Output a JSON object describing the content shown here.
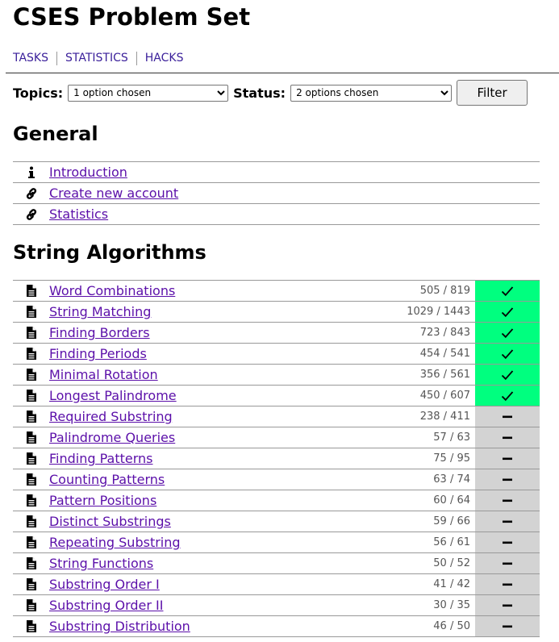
{
  "header": {
    "title": "CSES Problem Set"
  },
  "nav": [
    {
      "label": "TASKS"
    },
    {
      "label": "STATISTICS"
    },
    {
      "label": "HACKS"
    }
  ],
  "filter": {
    "topics_label": "Topics:",
    "topics_value": "1 option chosen",
    "status_label": "Status:",
    "status_value": "2 options chosen",
    "button_label": "Filter"
  },
  "general": {
    "heading": "General",
    "items": [
      {
        "icon": "info-icon",
        "label": "Introduction"
      },
      {
        "icon": "link-icon",
        "label": "Create new account"
      },
      {
        "icon": "link-icon",
        "label": "Statistics"
      }
    ]
  },
  "strings": {
    "heading": "String Algorithms",
    "items": [
      {
        "label": "Word Combinations",
        "count": "505 / 819",
        "solved": true
      },
      {
        "label": "String Matching",
        "count": "1029 / 1443",
        "solved": true
      },
      {
        "label": "Finding Borders",
        "count": "723 / 843",
        "solved": true
      },
      {
        "label": "Finding Periods",
        "count": "454 / 541",
        "solved": true
      },
      {
        "label": "Minimal Rotation",
        "count": "356 / 561",
        "solved": true
      },
      {
        "label": "Longest Palindrome",
        "count": "450 / 607",
        "solved": true
      },
      {
        "label": "Required Substring",
        "count": "238 / 411",
        "solved": false
      },
      {
        "label": "Palindrome Queries",
        "count": "57 / 63",
        "solved": false
      },
      {
        "label": "Finding Patterns",
        "count": "75 / 95",
        "solved": false
      },
      {
        "label": "Counting Patterns",
        "count": "63 / 74",
        "solved": false
      },
      {
        "label": "Pattern Positions",
        "count": "60 / 64",
        "solved": false
      },
      {
        "label": "Distinct Substrings",
        "count": "59 / 66",
        "solved": false
      },
      {
        "label": "Repeating Substring",
        "count": "56 / 61",
        "solved": false
      },
      {
        "label": "String Functions",
        "count": "50 / 52",
        "solved": false
      },
      {
        "label": "Substring Order I",
        "count": "41 / 42",
        "solved": false
      },
      {
        "label": "Substring Order II",
        "count": "30 / 35",
        "solved": false
      },
      {
        "label": "Substring Distribution",
        "count": "46 / 50",
        "solved": false
      }
    ]
  },
  "colors": {
    "solved": "#00ff7f",
    "unsolved": "#d3d3d3",
    "link": "#5b0fa9"
  }
}
